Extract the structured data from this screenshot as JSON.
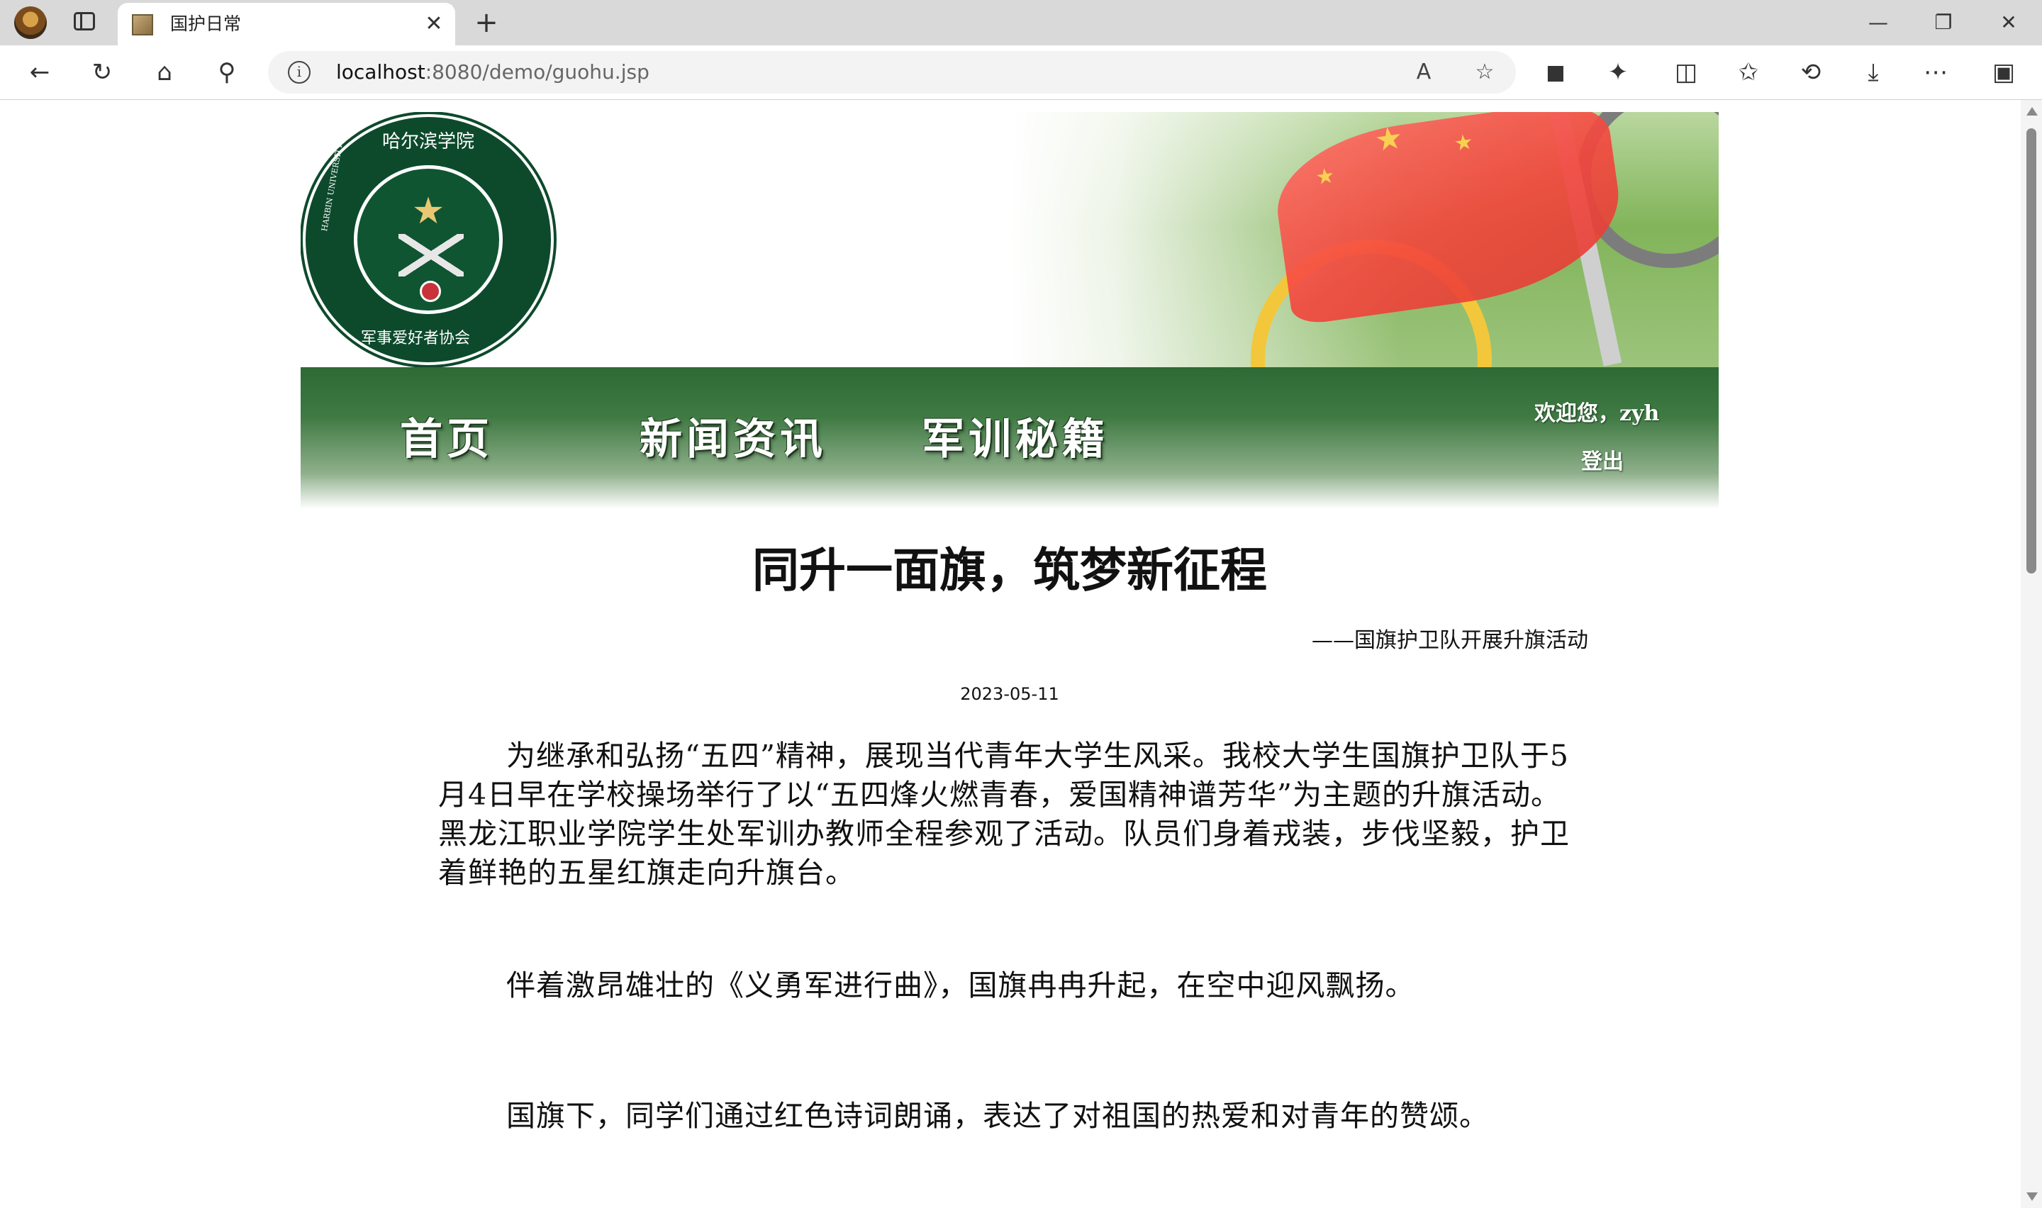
{
  "browser": {
    "tab_title": "国护日常",
    "tab_close": "✕",
    "new_tab": "+",
    "url_host": "localhost",
    "url_rest": ":8080/demo/guohu.jsp"
  },
  "header": {
    "emblem_text_cn_top": "哈尔滨学院",
    "emblem_text_cn_bottom": "军事爱好者协会",
    "emblem_text_en": "HARBIN UNIVERSITY"
  },
  "nav": {
    "items": [
      {
        "label": "首页"
      },
      {
        "label": "新闻资讯"
      },
      {
        "label": "军训秘籍"
      }
    ],
    "welcome": "欢迎您，zyh",
    "logout": "登出"
  },
  "article": {
    "title": "同升一面旗，筑梦新征程",
    "subtitle": "——国旗护卫队开展升旗活动",
    "date": "2023-05-11",
    "paragraphs": [
      "为继承和弘扬“五四”精神，展现当代青年大学生风采。我校大学生国旗护卫队于5月4日早在学校操场举行了以“五四烽火燃青春，爱国精神谱芳华”为主题的升旗活动。黑龙江职业学院学生处军训办教师全程参观了活动。队员们身着戎装，步伐坚毅，护卫着鲜艳的五星红旗走向升旗台。",
      "伴着激昂雄壮的《义勇军进行曲》，国旗冉冉升起，在空中迎风飘扬。",
      "国旗下，同学们通过红色诗词朗诵，表达了对祖国的热爱和对青年的赞颂。"
    ]
  },
  "colors": {
    "nav_green": "#2d6a34",
    "emblem_green": "#0d4a2c",
    "flag_red": "#f4453c"
  }
}
